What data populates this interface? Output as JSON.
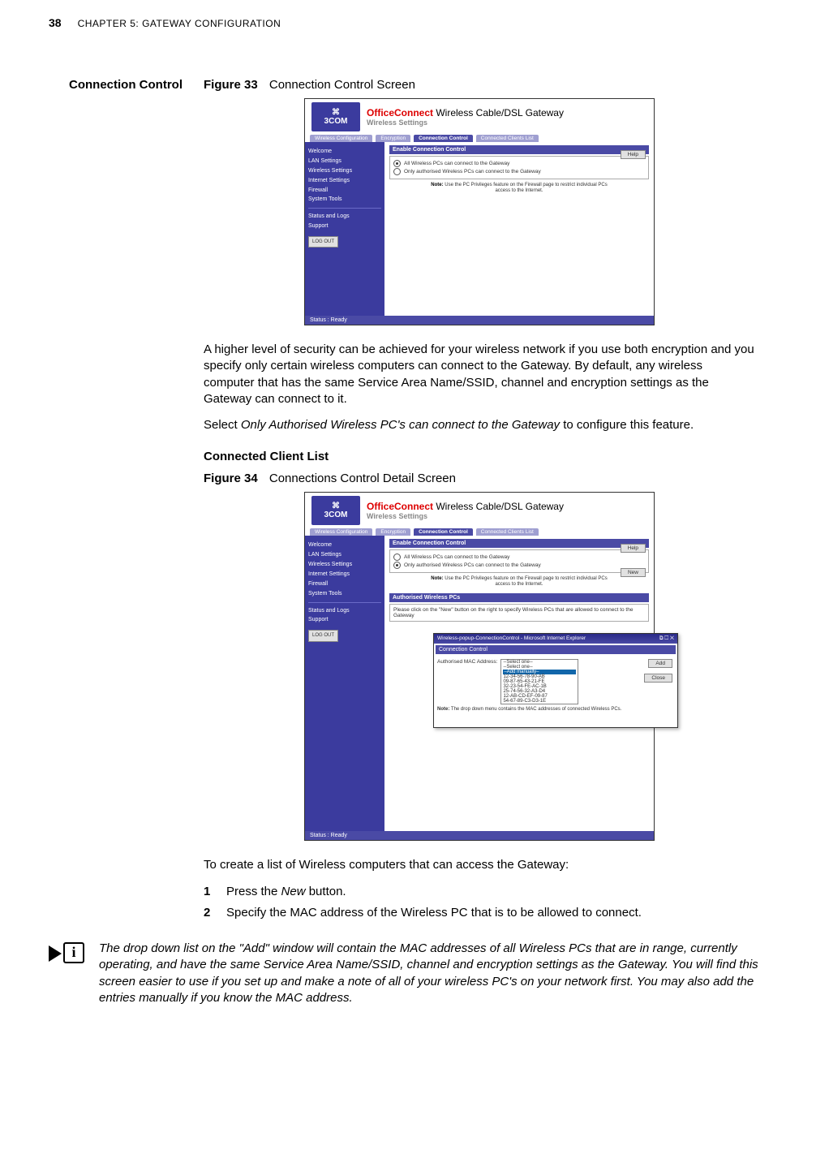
{
  "page": {
    "number": "38",
    "chapter": "CHAPTER 5: GATEWAY CONFIGURATION"
  },
  "section_title": "Connection Control",
  "figure33": {
    "label": "Figure 33",
    "caption": "Connection Control Screen"
  },
  "figure34": {
    "label": "Figure 34",
    "caption": "Connections Control Detail Screen"
  },
  "shot": {
    "logo": "3COM",
    "brand": "OfficeConnect",
    "brand_suffix": " Wireless Cable/DSL Gateway",
    "ws_label": "Wireless Settings",
    "tabs": {
      "wc": "Wireless Configuration",
      "enc": "Encryption",
      "cc": "Connection Control",
      "ccl": "Connected Clients List"
    },
    "sidebar": {
      "welcome": "Welcome",
      "lan": "LAN Settings",
      "ws": "Wireless Settings",
      "is": "Internet Settings",
      "fw": "Firewall",
      "st": "System Tools",
      "sl": "Status and Logs",
      "sup": "Support",
      "logout": "LOG OUT"
    },
    "panel1": {
      "title": "Enable Connection Control",
      "opt1": "All Wireless PCs can connect to the Gateway",
      "opt2": "Only authorised Wireless PCs can connect to the Gateway",
      "note": "Use the PC Privileges feature on the Firewall page to restrict individual PCs access to the Internet.",
      "note_label": "Note:"
    },
    "panel2": {
      "title": "Authorised Wireless PCs",
      "text": "Please click on the \"New\" button on the right to specify Wireless PCs that are allowed to connect to the Gateway"
    },
    "buttons": {
      "help": "Help",
      "new": "New",
      "add": "Add",
      "close": "Close"
    },
    "status": "Status : Ready",
    "popup": {
      "titlebar": "Wireless-popup-ConnectionControl - Microsoft Internet Explorer",
      "header": "Connection Control",
      "mac_label": "Authorised MAC Address:",
      "sel_placeholder": "--Select one--",
      "add_manually": "–Add manually–",
      "macs": [
        "12-34-56-78-90-AB",
        "09-87-65-43-21-FE",
        "32-23-54-FE-AC-1B",
        "25-74-56-32-A3-D4",
        "12-AB-CD-EF-09-87",
        "54-67-89-C3-D3-1E"
      ],
      "note_label": "Note:",
      "note": "The drop down menu contains the MAC addresses of connected Wireless PCs."
    }
  },
  "body": {
    "intro": "A higher level of security can be achieved for your wireless network if you use both encryption and you specify only certain wireless computers can connect to the Gateway. By default, any wireless computer that has the same Service Area Name/SSID, channel and encryption settings as the Gateway can connect to it.",
    "select_pre": "Select ",
    "select_em": "Only Authorised Wireless PC's can connect to the Gateway",
    "select_post": " to configure this feature.",
    "ccl_heading": "Connected Client List",
    "tocreate": "To create a list of Wireless computers that can access the Gateway:",
    "step1_pre": "Press the ",
    "step1_em": "New",
    "step1_post": " button.",
    "step2": "Specify the MAC address of the Wireless PC that is to be allowed to connect.",
    "info": "The drop down list on the \"Add\" window will contain the MAC addresses of all Wireless PCs that are in range, currently operating, and have the same Service Area Name/SSID, channel and encryption settings as the Gateway. You will find this screen easier to use if you set up and make a note of all of your wireless PC's on your network first. You may also add the entries manually if you know the MAC address."
  }
}
